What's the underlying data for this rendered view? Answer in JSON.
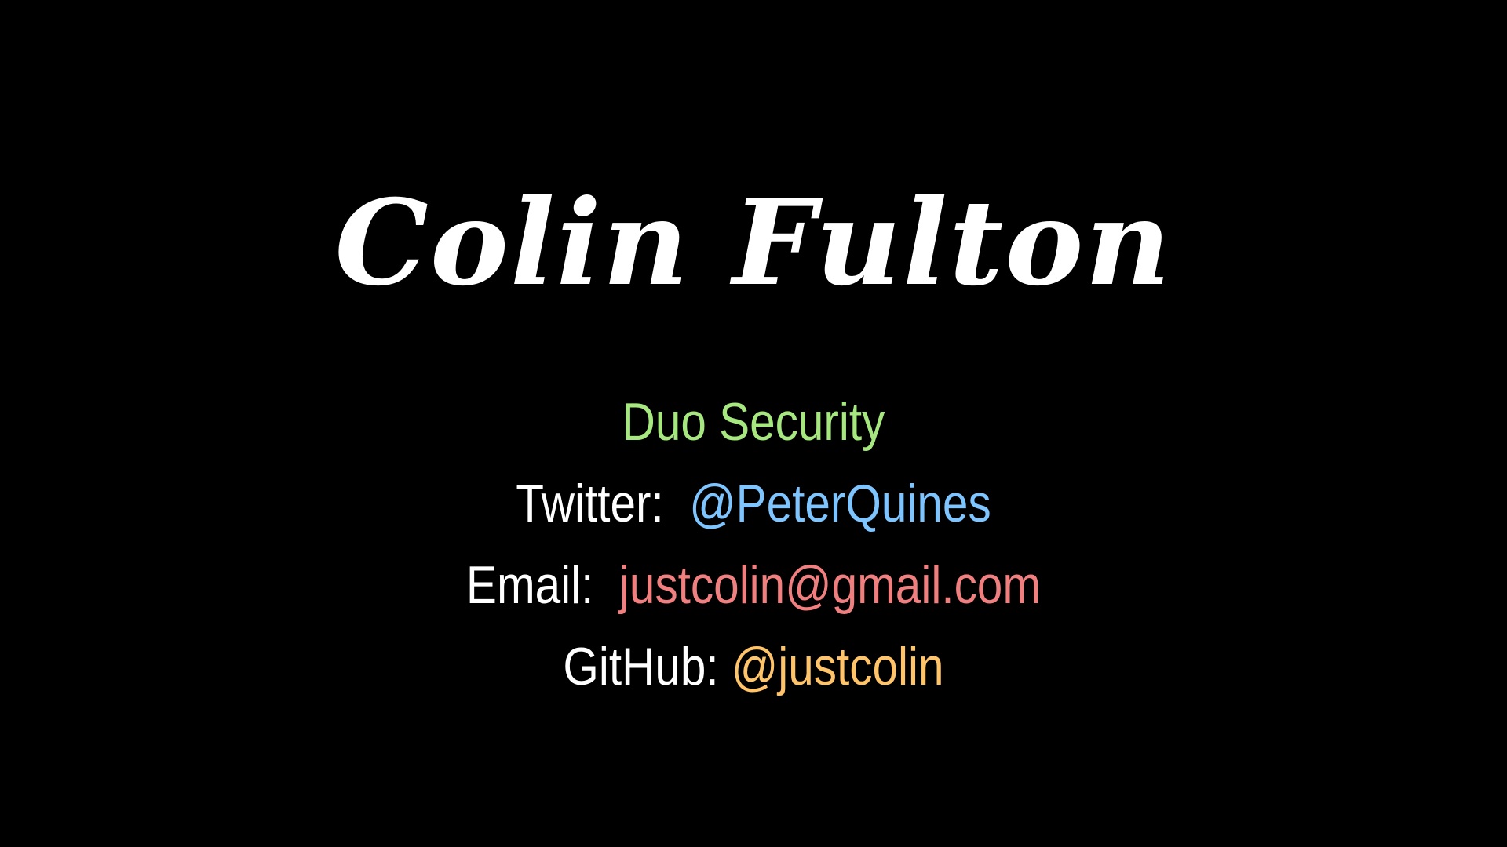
{
  "slide": {
    "title": "Colin Fulton",
    "organization": "Duo Security",
    "contacts": [
      {
        "label": "Twitter:",
        "value": "@PeterQuines"
      },
      {
        "label": "Email:",
        "value": "justcolin@gmail.com"
      },
      {
        "label": "GitHub:",
        "value": "@justcolin"
      }
    ]
  },
  "colors": {
    "background": "#000000",
    "title": "#ffffff",
    "organization": "#a6e87f",
    "twitter_value": "#7ec4ff",
    "email_value": "#f07f7f",
    "github_value": "#ffc46a",
    "label": "#ffffff"
  }
}
